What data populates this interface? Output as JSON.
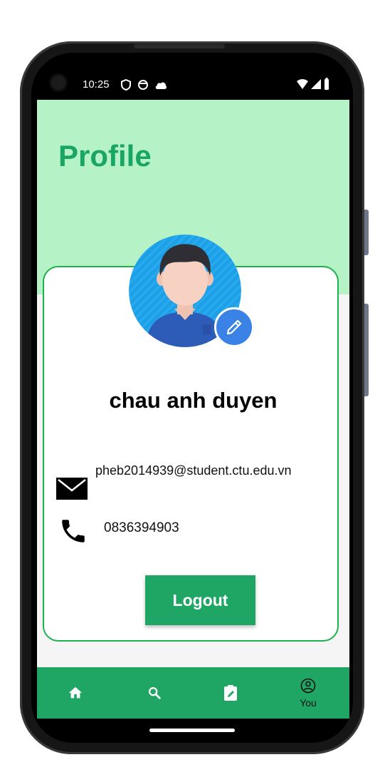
{
  "status_bar": {
    "time": "10:25"
  },
  "page": {
    "title": "Profile"
  },
  "profile": {
    "name": "chau anh duyen",
    "email": "pheb2014939@student.ctu.edu.vn",
    "phone": "0836394903"
  },
  "actions": {
    "logout_label": "Logout"
  },
  "bottom_nav": {
    "items": [
      {
        "icon": "home-icon",
        "label": ""
      },
      {
        "icon": "search-icon",
        "label": ""
      },
      {
        "icon": "clipboard-edit-icon",
        "label": ""
      },
      {
        "icon": "account-circle-icon",
        "label": "You",
        "selected": true
      }
    ]
  },
  "colors": {
    "header_bg": "#b5f3c6",
    "accent": "#1fa665",
    "title": "#1aa564",
    "card_border": "#1fb04f",
    "edit_button": "#3b82e6"
  }
}
